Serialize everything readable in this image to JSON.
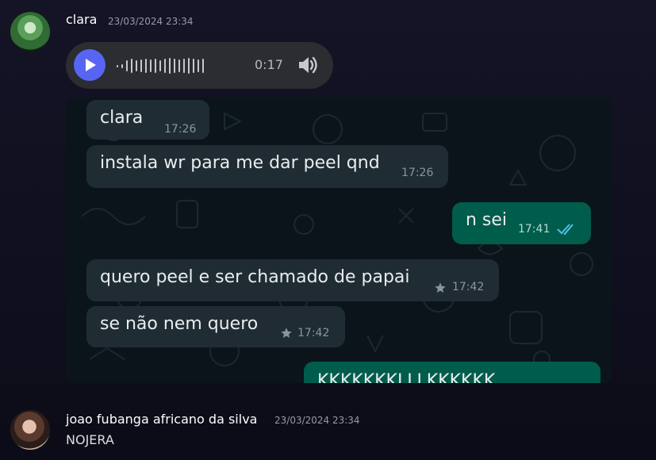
{
  "messages": [
    {
      "author": "clara",
      "timestamp": "23/03/2024 23:34",
      "voice": {
        "duration": "0:17"
      },
      "whatsapp": {
        "bubbles": [
          {
            "dir": "in",
            "text": "clara",
            "time": "17:26"
          },
          {
            "dir": "in",
            "text": "instala wr para me dar peel qnd",
            "time": "17:26"
          },
          {
            "dir": "out",
            "text": "n sei",
            "time": "17:41"
          },
          {
            "dir": "in",
            "text": "quero peel e ser chamado de papai",
            "time": "17:42",
            "starred": true
          },
          {
            "dir": "in",
            "text": "se não nem quero",
            "time": "17:42",
            "starred": true
          },
          {
            "dir": "out",
            "text": "KKKKKKKLLLKKKKKK",
            "time": ""
          }
        ]
      }
    },
    {
      "author": "joao fubanga africano da silva",
      "timestamp": "23/03/2024 23:34",
      "text": "NOJERA"
    }
  ],
  "colors": {
    "accent": "#5865f2",
    "wa_outgoing": "#005c4b",
    "wa_incoming": "#202c33",
    "wa_read_ticks": "#53bdeb"
  },
  "icons": [
    "play-icon",
    "volume-icon",
    "star-icon",
    "double-check-icon"
  ]
}
